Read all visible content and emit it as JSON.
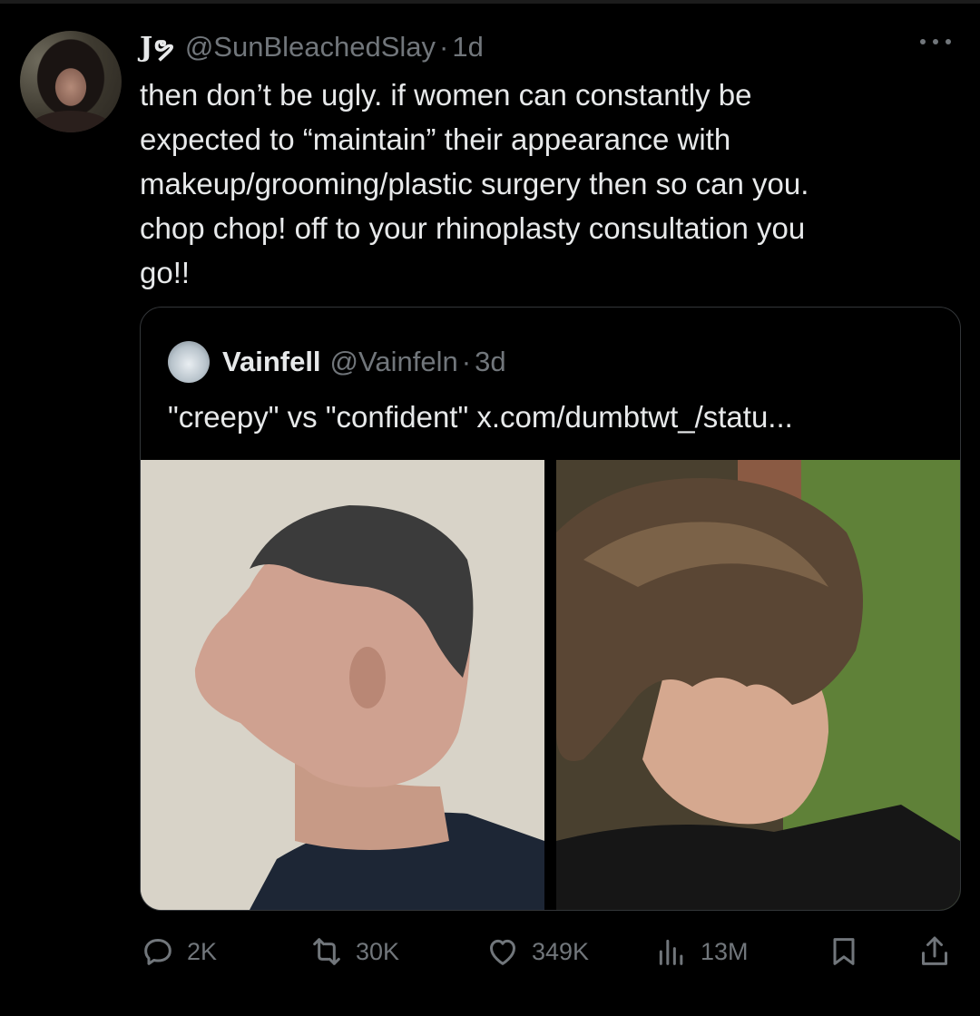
{
  "tweet": {
    "display_name": "Jຯ",
    "handle": "@SunBleachedSlay",
    "separator": "·",
    "time": "1d",
    "text_lines": [
      "then don’t be ugly. if women can constantly be",
      "expected to “maintain” their appearance with",
      "makeup/grooming/plastic surgery then so can you.",
      "chop chop! off to your rhinoplasty consultation you",
      "go!!"
    ]
  },
  "quote": {
    "display_name": "Vainfell",
    "handle": "@Vainfeln",
    "separator": "·",
    "time": "3d",
    "text": "\"creepy\" vs \"confident\" x.com/dumbtwt_/statu..."
  },
  "actions": {
    "replies": "2K",
    "reposts": "30K",
    "likes": "349K",
    "views": "13M"
  },
  "icons": {
    "avatar": "user-avatar",
    "more": "more-icon",
    "reply": "reply-icon",
    "repost": "repost-icon",
    "like": "heart-icon",
    "views": "views-icon",
    "bookmark": "bookmark-icon",
    "share": "share-icon"
  },
  "colors": {
    "background": "#000000",
    "text": "#e7e9ea",
    "secondary": "#71767b",
    "border": "#333639"
  }
}
